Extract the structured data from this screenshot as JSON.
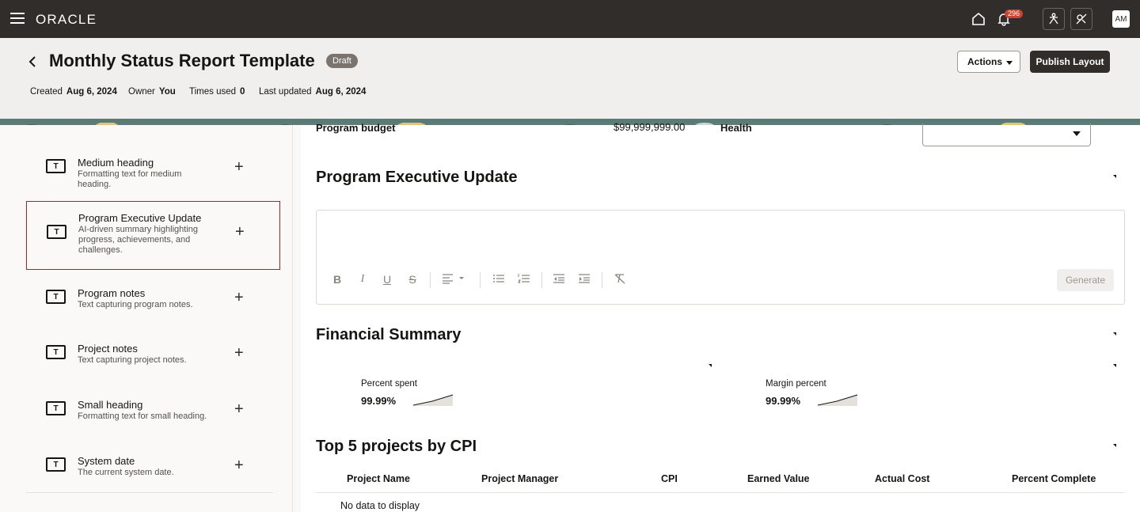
{
  "header": {
    "brand": "ORACLE",
    "notification_count": "296",
    "avatar_initials": "AM"
  },
  "page": {
    "title": "Monthly Status Report Template",
    "status": "Draft",
    "meta": [
      {
        "label": "Created",
        "value": "Aug 6, 2024"
      },
      {
        "label": "Owner",
        "value": "You"
      },
      {
        "label": "Times used",
        "value": "0"
      },
      {
        "label": "Last updated",
        "value": "Aug 6, 2024"
      }
    ],
    "actions_label": "Actions",
    "publish_label": "Publish Layout"
  },
  "components": [
    {
      "title": "Medium heading",
      "desc": "Formatting text for medium heading."
    },
    {
      "title": "Program Executive Update",
      "desc": "AI-driven summary highlighting progress, achievements, and challenges."
    },
    {
      "title": "Program notes",
      "desc": "Text capturing program notes."
    },
    {
      "title": "Project notes",
      "desc": "Text capturing project notes."
    },
    {
      "title": "Small heading",
      "desc": "Formatting text for small heading."
    },
    {
      "title": "System date",
      "desc": "The current system date."
    }
  ],
  "canvas": {
    "budget_label": "Program budget",
    "budget_value": "$99,999,999.00",
    "health_label": "Health",
    "exec_update_title": "Program Executive Update",
    "generate_label": "Generate",
    "financial_title": "Financial Summary",
    "metrics": [
      {
        "label": "Percent spent",
        "value": "99.99%"
      },
      {
        "label": "Margin percent",
        "value": "99.99%"
      }
    ],
    "top5_title": "Top 5 projects by CPI",
    "table_headers": [
      "Project Name",
      "Project Manager",
      "CPI",
      "Earned Value",
      "Actual Cost",
      "Percent Complete"
    ],
    "no_data": "No data to display"
  },
  "colors": {
    "topbar": "#312d2a",
    "selected_border": "#b1221d",
    "badge": "#c74634"
  }
}
